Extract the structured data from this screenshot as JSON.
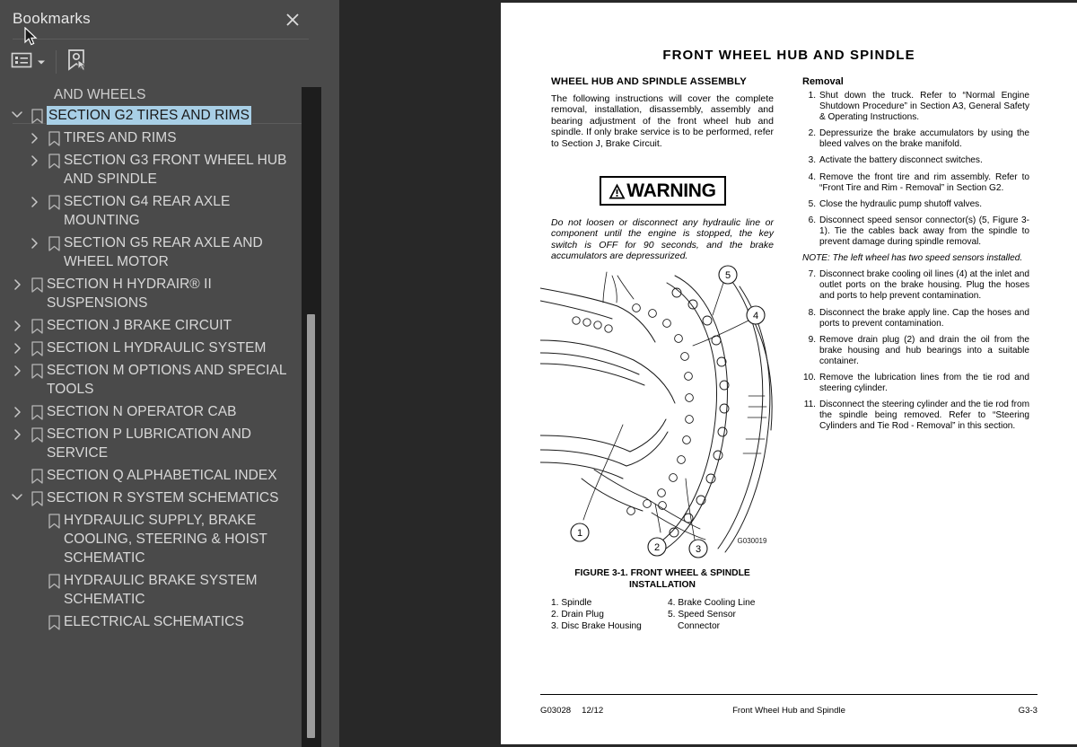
{
  "panel": {
    "title": "Bookmarks",
    "close_icon": "close-icon",
    "toolbar": {
      "view_options_label": "view-options",
      "new_bookmark_label": "new-bookmark"
    },
    "truncated_top_item": "AND WHEELS",
    "items": [
      {
        "label": "SECTION G2 TIRES AND RIMS",
        "depth": 0,
        "twisty": "down",
        "selected": true
      },
      {
        "label": "TIRES AND RIMS",
        "depth": 1,
        "twisty": "right",
        "selected": false
      },
      {
        "label": "SECTION G3 FRONT WHEEL HUB AND SPINDLE",
        "depth": 1,
        "twisty": "right",
        "selected": false
      },
      {
        "label": "SECTION G4 REAR AXLE MOUNTING",
        "depth": 1,
        "twisty": "right",
        "selected": false
      },
      {
        "label": "SECTION G5 REAR AXLE AND WHEEL MOTOR",
        "depth": 1,
        "twisty": "right",
        "selected": false
      },
      {
        "label": "SECTION H HYDRAIR® II SUSPENSIONS",
        "depth": 0,
        "twisty": "right",
        "selected": false
      },
      {
        "label": "SECTION J BRAKE CIRCUIT",
        "depth": 0,
        "twisty": "right",
        "selected": false
      },
      {
        "label": "SECTION L HYDRAULIC SYSTEM",
        "depth": 0,
        "twisty": "right",
        "selected": false
      },
      {
        "label": "SECTION M OPTIONS AND SPECIAL TOOLS",
        "depth": 0,
        "twisty": "right",
        "selected": false
      },
      {
        "label": "SECTION N OPERATOR CAB",
        "depth": 0,
        "twisty": "right",
        "selected": false
      },
      {
        "label": "SECTION P LUBRICATION AND SERVICE",
        "depth": 0,
        "twisty": "right",
        "selected": false
      },
      {
        "label": "SECTION Q ALPHABETICAL INDEX",
        "depth": 0,
        "twisty": "none",
        "selected": false
      },
      {
        "label": "SECTION R SYSTEM SCHEMATICS",
        "depth": 0,
        "twisty": "down",
        "selected": false
      },
      {
        "label": "HYDRAULIC SUPPLY, BRAKE COOLING, STEERING & HOIST SCHEMATIC",
        "depth": 1,
        "twisty": "none",
        "selected": false
      },
      {
        "label": "HYDRAULIC BRAKE SYSTEM SCHEMATIC",
        "depth": 1,
        "twisty": "none",
        "selected": false
      },
      {
        "label": "ELECTRICAL SCHEMATICS",
        "depth": 1,
        "twisty": "none",
        "selected": false
      }
    ],
    "selection_color": "#a8cfe6",
    "background_color": "#4a4a4a"
  },
  "divider": {
    "collapse_icon": "triangle-left-icon"
  },
  "document": {
    "page_title": "FRONT WHEEL HUB AND SPINDLE",
    "left_column": {
      "heading": "WHEEL HUB AND SPINDLE ASSEMBLY",
      "intro": "The following instructions will cover the complete removal, installation, disassembly, assembly and bearing adjustment of the front wheel hub and spindle. If only brake service is to be performed, refer to Section J, Brake Circuit.",
      "warning_label": "WARNING",
      "warning_text": "Do not loosen or disconnect any hydraulic line or component until the engine is stopped, the key switch is OFF for 90 seconds, and the brake accumulators are depressurized."
    },
    "right_column": {
      "heading": "Removal",
      "steps": [
        {
          "num": "1.",
          "text": "Shut down the truck. Refer to “Normal Engine Shutdown Procedure” in Section A3, General Safety & Operating Instructions."
        },
        {
          "num": "2.",
          "text": "Depressurize the brake accumulators by using the bleed valves on the brake manifold."
        },
        {
          "num": "3.",
          "text": "Activate the battery disconnect switches."
        },
        {
          "num": "4.",
          "text": "Remove the front tire and rim assembly. Refer to “Front Tire and Rim - Removal” in Section G2."
        },
        {
          "num": "5.",
          "text": "Close the hydraulic pump shutoff valves."
        },
        {
          "num": "6.",
          "text": "Disconnect speed sensor connector(s) (5, Figure 3-1). Tie the cables back away from the spindle to prevent damage during spindle removal."
        }
      ],
      "note": "NOTE: The left wheel has two speed sensors installed.",
      "steps_after_note": [
        {
          "num": "7.",
          "text": "Disconnect brake cooling oil lines (4) at the inlet and outlet ports on the brake housing. Plug the hoses and ports to help prevent contamination."
        },
        {
          "num": "8.",
          "text": "Disconnect the brake apply line. Cap the hoses and ports to prevent contamination."
        },
        {
          "num": "9.",
          "text": "Remove drain plug (2) and drain the oil from the brake housing and hub bearings into a suitable container."
        },
        {
          "num": "10.",
          "text": "Remove the lubrication lines from the tie rod and steering cylinder."
        },
        {
          "num": "11.",
          "text": "Disconnect the steering cylinder and the tie rod from the spindle being removed. Refer to “Steering Cylinders and Tie Rod - Removal” in this section."
        }
      ]
    },
    "figure": {
      "drawing_id": "G030019",
      "caption_line1": "FIGURE 3-1. FRONT WHEEL & SPINDLE",
      "caption_line2": "INSTALLATION",
      "callouts": [
        "1",
        "2",
        "3",
        "4",
        "5"
      ],
      "legend_left": [
        "1. Spindle",
        "2. Drain Plug",
        "3. Disc Brake Housing"
      ],
      "legend_right": [
        "4. Brake Cooling Line",
        "5. Speed Sensor",
        "Connector"
      ]
    },
    "footer": {
      "doc_code": "G03028",
      "revision": "12/12",
      "center": "Front Wheel Hub and Spindle",
      "page_number": "G3-3"
    }
  }
}
